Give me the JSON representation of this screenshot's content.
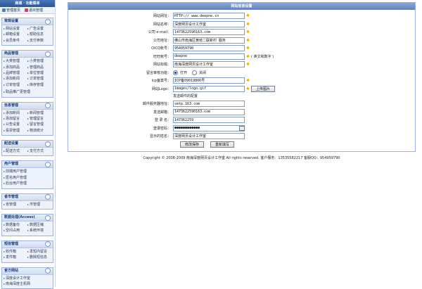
{
  "sidebar": {
    "title": "商城 · 功能菜单",
    "quick_links": [
      "管理首页",
      "退出管理"
    ],
    "groups": [
      {
        "title": "常规设置",
        "items": [
          "网站设置",
          "广告设置",
          "邮箱设置",
          "帮助信息",
          "会员条件",
          "支付参数"
        ]
      },
      {
        "title": "商品管理",
        "items": [
          "大类管理",
          "小类管理",
          "添加商品",
          "管理商品",
          "品牌管理",
          "单位管理",
          "添加新闻",
          "订单管理",
          "订单管理",
          "库存管理",
          "取品推广更管理"
        ]
      },
      {
        "title": "信息管理",
        "items": [
          "添加新闻",
          "新闻管理",
          "添加留言",
          "管理留言",
          "公告设置",
          "留言管理",
          "投票管理",
          "物流统计"
        ]
      },
      {
        "title": "配送设置",
        "items": [
          "配送方式",
          "支付方式"
        ]
      },
      {
        "title": "用户管理",
        "items": [
          "前端用户管理",
          "匿名用户管理",
          "后台用户管理"
        ]
      },
      {
        "title": "省市管理",
        "items": [
          "省管理",
          "市管理"
        ]
      },
      {
        "title": "数据处理(Access)",
        "items": [
          "数据备份",
          "数据压缩",
          "空间占用",
          "系统环境"
        ]
      },
      {
        "title": "短信管理",
        "items": [
          "收件箱",
          "发短内留言",
          "发件箱",
          "删除短信息"
        ]
      },
      {
        "title": "官方网站",
        "items": [
          "深度设计工作室",
          "南海深度主机网"
        ]
      }
    ]
  },
  "panel": {
    "title": "网站信息设置",
    "fields": {
      "site_url": {
        "label": "网站网址：",
        "value": "HTTP:// www.deepne.cn"
      },
      "site_name": {
        "label": "网站名称：",
        "value": "深度网页设计工作室"
      },
      "company_email": {
        "label": "公司 e-mail：",
        "value": "1473622590163.com"
      },
      "company_address": {
        "label": "公司地址：",
        "value": "佛山市南海区黄岐二联新村 服务"
      },
      "oicq": {
        "label": "OICQ账号：",
        "value": "954959790"
      },
      "owner_name": {
        "label": "旺旺帐号：",
        "value": "deepne",
        "note": "( 英文和数字 )"
      },
      "site_title": {
        "label": "网站标题：",
        "value": "南海深度网页设计工作室"
      },
      "guestbook_audit": {
        "label": "留言审核功能：",
        "options": [
          "打开",
          "关闭"
        ],
        "selected": "打开"
      },
      "icp": {
        "label": "Icp备案号：",
        "value": "ICP备09019806号"
      },
      "logo": {
        "label": "网站Logo：",
        "value": "images/logo.gif",
        "button": "上传图片"
      },
      "mail_section": "发送邮件的配置",
      "smtp": {
        "label": "邮件服务器地址：",
        "value": "smtp.163.com"
      },
      "sender": {
        "label": "发送邮箱：",
        "value": "1473622590163.com"
      },
      "login_name": {
        "label": "登 录 名：",
        "value": "147362259"
      },
      "login_password": {
        "label": "登录密码：",
        "value": "●●●●●●●●●●●●"
      },
      "display_name": {
        "label": "显示的姓名：",
        "value": "深度网页设计工作室"
      }
    },
    "buttons": {
      "save": "修改保存",
      "reset": "重新填写"
    }
  },
  "footer": {
    "copyright": "Copyright © 2008-2009 南海深度网页设计工作室 All rights reserved. 客户服务：13535582217 客服QQ：954959790"
  },
  "colors": {
    "accent": "#27549a",
    "panel_head": "#6f90c9",
    "border": "#9db3d9",
    "star": "#e0b000"
  }
}
